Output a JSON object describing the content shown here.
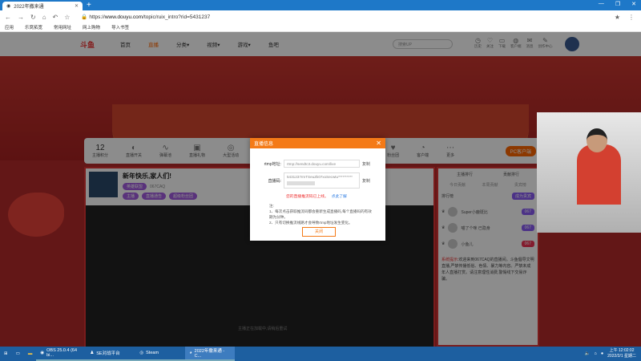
{
  "browser": {
    "tab_title": "2022年撒来通",
    "url_prefix": "https://",
    "url_domain": "www.douyu.com",
    "url_path": "/topic/ruix_intro?rid=5431237",
    "bookmarks": [
      "应用",
      "乐窝拓宽",
      "常用网址",
      "网上购物",
      "导入书签"
    ]
  },
  "site": {
    "logo": "斗鱼",
    "nav": [
      "首页",
      "直播",
      "分类▾",
      "视频▾",
      "游戏▾",
      "鱼吧"
    ],
    "search_placeholder": "搜索UP",
    "nav_icons": [
      "历史",
      "关注",
      "下载",
      "客户端",
      "消息",
      "创作中心"
    ]
  },
  "toolbar": {
    "score": "12",
    "score_label": "主播积分",
    "items": [
      "直播开关",
      "弹幕池",
      "直播礼物",
      "大型活动",
      "粉丝团",
      "客户端",
      "更多"
    ],
    "pc_button": "PC客户端"
  },
  "stream": {
    "title": "新年快乐,家人们!",
    "category": "英雄联盟",
    "room_id": "067CAQ",
    "tags": [
      "主播",
      "直播通告",
      "超级粉丝团"
    ],
    "video_hint": "主播正在加载中,请稍后重试"
  },
  "side": {
    "tabs": [
      "主播排行",
      "贡献排行"
    ],
    "subtabs": [
      "今日贡献",
      "本周贡献",
      "贵宾榜"
    ],
    "rank_label": "排行榜",
    "rank_button": "成为贵宾",
    "users": [
      {
        "name": "Super小鹿斑比",
        "badge": "067"
      },
      {
        "name": "喵了个咪 已隐身",
        "badge": "067"
      },
      {
        "name": "小鱼儿",
        "badge": "067"
      }
    ],
    "notice_prefix": "系统提示:",
    "notice": "欢迎来到067CAQ的直播间。斗鱼倡导文明直播,严禁传播低俗、色情、暴力等内容。严禁未成年人直播打赏。请注意理性消费,警惕线下交易诈骗。"
  },
  "modal": {
    "title": "直播信息",
    "rtmp_label": "rtmp地址:",
    "rtmp_value": "rtmp://sendtc3.douyu.com/live",
    "key_label": "直播码:",
    "key_value": "5431237rmTSeuZk07xxSecwtu**********",
    "copy": "复制",
    "warning": "您的直播推流码已上线。",
    "learn_more": "点此了解",
    "notes_title": "注:",
    "notes": [
      "1、每次点击获取推流码都会重新生成直播码,每个直播码的有效期为分钟。",
      "2、只有切换推流线路才会导致rtmp地址发生变化。"
    ],
    "close": "关闭"
  },
  "taskbar": {
    "apps": [
      "OBS 25.0.4 (64 bi...",
      "SE对战平台",
      "Steam",
      "2022年撒来通 - C..."
    ],
    "time": "上午 12:02:02",
    "date": "2022/2/1 星期二"
  }
}
